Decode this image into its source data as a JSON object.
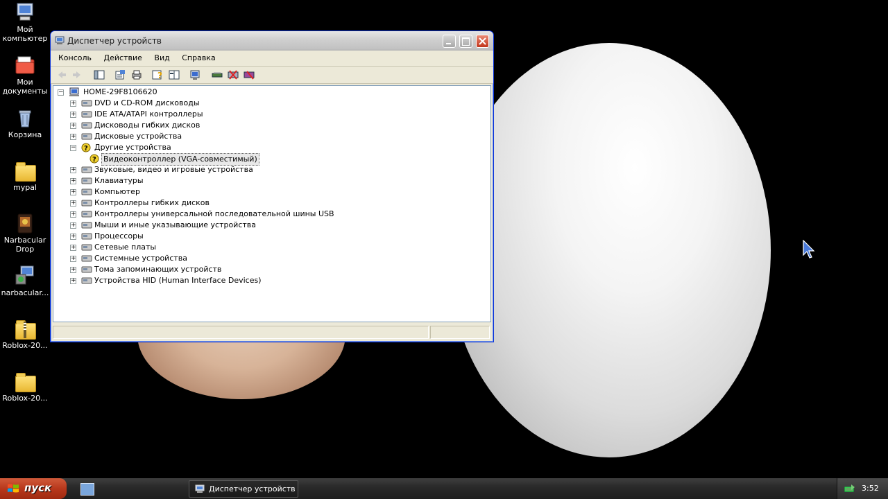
{
  "desktop": {
    "icons": [
      {
        "label": "Мой компьютер",
        "icon": "my-computer-icon"
      },
      {
        "label": "Мои документы",
        "icon": "my-documents-icon"
      },
      {
        "label": "Корзина",
        "icon": "recycle-bin-icon"
      },
      {
        "label": "mypal",
        "icon": "folder-icon"
      },
      {
        "label": "Narbacular Drop",
        "icon": "game-icon"
      },
      {
        "label": "narbacular...",
        "icon": "installer-icon"
      },
      {
        "label": "Roblox-20...",
        "icon": "zip-folder-icon"
      },
      {
        "label": "Roblox-20...",
        "icon": "folder-icon"
      }
    ]
  },
  "window": {
    "title": "Диспетчер устройств",
    "menu": [
      "Консоль",
      "Действие",
      "Вид",
      "Справка"
    ],
    "toolbar_icons": [
      "back-icon",
      "forward-icon",
      "show-hide-tree-icon",
      "properties-icon",
      "print-icon",
      "help-icon",
      "view-icon",
      "scan-hardware-icon",
      "update-driver-icon",
      "disable-device-icon",
      "uninstall-device-icon"
    ],
    "tree": {
      "root": "HOME-29F8106620",
      "nodes": [
        {
          "label": "DVD и CD-ROM дисководы",
          "expanded": false
        },
        {
          "label": "IDE ATA/ATAPI контроллеры",
          "expanded": false
        },
        {
          "label": "Дисководы гибких дисков",
          "expanded": false
        },
        {
          "label": "Дисковые устройства",
          "expanded": false
        },
        {
          "label": "Другие устройства",
          "expanded": true
        },
        {
          "label": "Видеоконтроллер (VGA-совместимый)",
          "child": true,
          "selected": true
        },
        {
          "label": "Звуковые, видео и игровые устройства",
          "expanded": false
        },
        {
          "label": "Клавиатуры",
          "expanded": false
        },
        {
          "label": "Компьютер",
          "expanded": false
        },
        {
          "label": "Контроллеры гибких дисков",
          "expanded": false
        },
        {
          "label": "Контроллеры универсальной последовательной шины USB",
          "expanded": false
        },
        {
          "label": "Мыши и иные указывающие устройства",
          "expanded": false
        },
        {
          "label": "Процессоры",
          "expanded": false
        },
        {
          "label": "Сетевые платы",
          "expanded": false
        },
        {
          "label": "Системные устройства",
          "expanded": false
        },
        {
          "label": "Тома запоминающих устройств",
          "expanded": false
        },
        {
          "label": "Устройства HID (Human Interface Devices)",
          "expanded": false
        }
      ]
    }
  },
  "taskbar": {
    "start_label": "пуск",
    "task_label": "Диспетчер устройств",
    "clock": "3:52"
  }
}
